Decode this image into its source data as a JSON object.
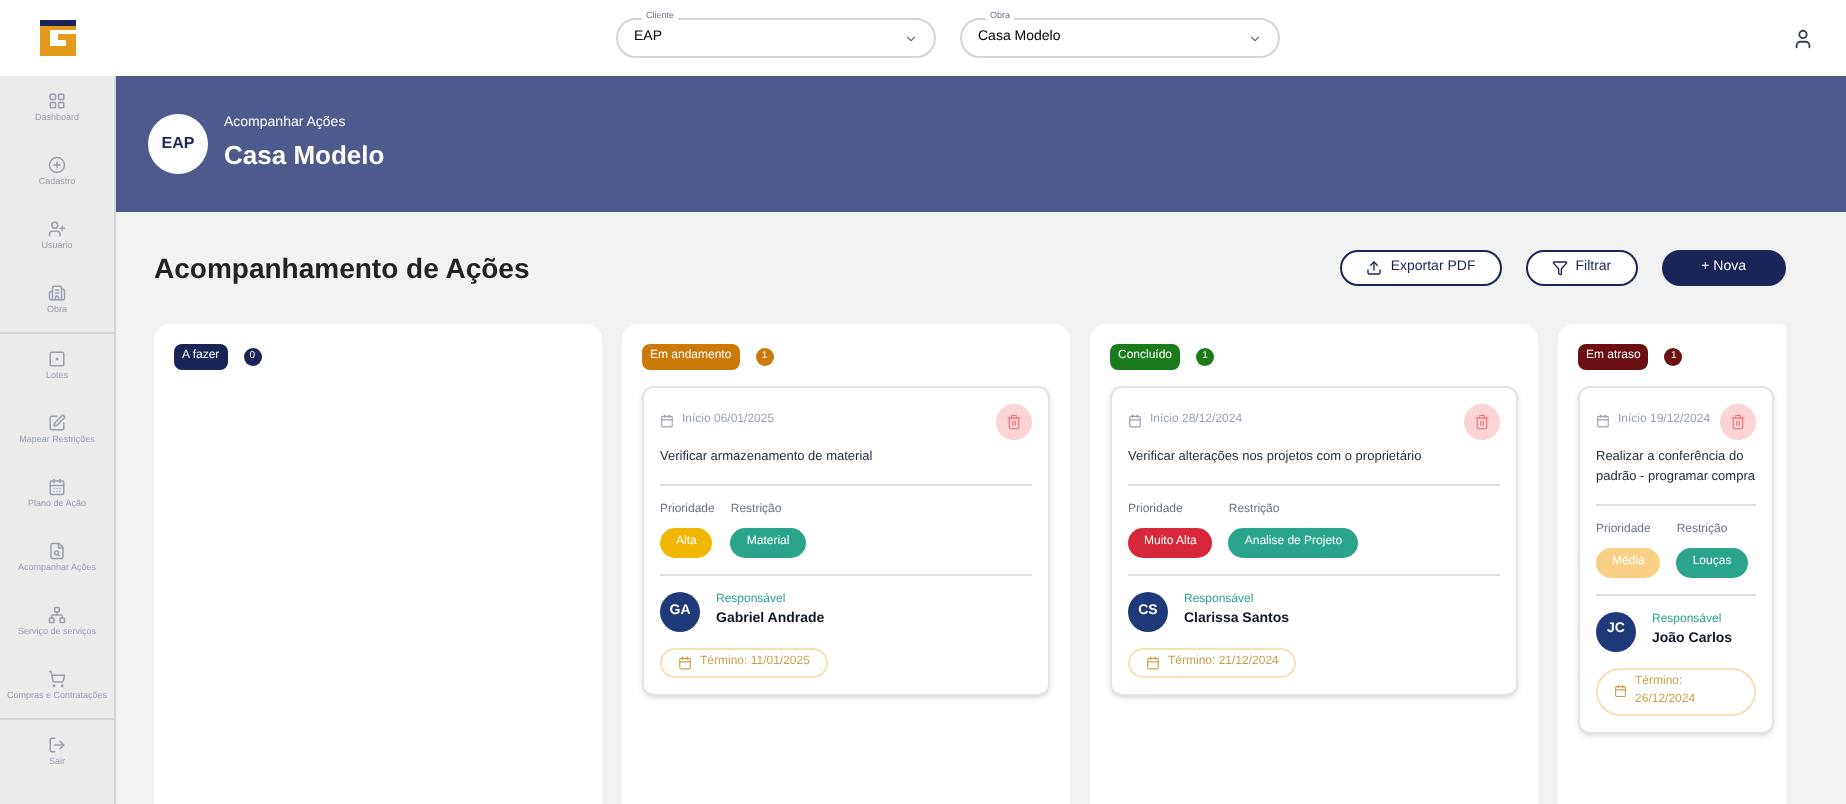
{
  "topbar": {
    "fields": [
      {
        "label": "Cliente",
        "value": "EAP"
      },
      {
        "label": "Obra",
        "value": "Casa Modelo"
      }
    ]
  },
  "sidebar": {
    "items": [
      {
        "label": "Dashboard"
      },
      {
        "label": "Cadastro"
      },
      {
        "label": "Usuário"
      },
      {
        "label": "Obra"
      },
      {
        "label": "Lotes"
      },
      {
        "label": "Mapear Restrições"
      },
      {
        "label": "Plano de Ação"
      },
      {
        "label": "Acompanhar Ações"
      },
      {
        "label": "Serviço de serviços"
      },
      {
        "label": "Compras e Contratações"
      },
      {
        "label": "Sair"
      }
    ]
  },
  "header": {
    "logo": "EAP",
    "subtitle": "Acompanhar Ações",
    "title": "Casa Modelo"
  },
  "page_title": "Acompanhamento de Ações",
  "buttons": [
    {
      "label": "Exportar PDF",
      "kind": "export"
    },
    {
      "label": "Filtrar",
      "kind": "filter"
    },
    {
      "label": "+ Nova",
      "kind": "primary"
    }
  ],
  "columns": [
    {
      "label": "A fazer",
      "count": "0",
      "color": "#1a2456"
    },
    {
      "label": "Em andamento",
      "count": "1",
      "color": "#c97a0a",
      "cards": [
        {
          "start": "Início 06/01/2025",
          "title": "Verificar armazenamento de material",
          "priority_label": "Prioridade",
          "restriction_label": "Restrição",
          "priority": {
            "label": "Alta",
            "color": "#f2b705"
          },
          "restriction": "Material",
          "responsible_label": "Responsável",
          "initials": "GA",
          "name": "Gabriel Andrade",
          "end": "Término: 11/01/2025"
        }
      ]
    },
    {
      "label": "Concluído",
      "count": "1",
      "color": "#1b7a1b",
      "cards": [
        {
          "start": "Início 28/12/2024",
          "title": "Verificar alterações nos projetos com o proprietário",
          "priority_label": "Prioridade",
          "restriction_label": "Restrição",
          "priority": {
            "label": "Muito Alta",
            "color": "#d62839"
          },
          "restriction": "Analise de Projeto",
          "responsible_label": "Responsável",
          "initials": "CS",
          "name": "Clarissa Santos",
          "end": "Término: 21/12/2024"
        }
      ]
    },
    {
      "label": "Em atraso",
      "count": "1",
      "color": "#6b0f12",
      "cards": [
        {
          "start": "Início 19/12/2024",
          "title": "Realizar a conferência do padrão - programar compra",
          "priority_label": "Prioridade",
          "restriction_label": "Restrição",
          "priority": {
            "label": "Média",
            "color": "#f7cf85"
          },
          "restriction": "Louças",
          "responsible_label": "Responsável",
          "initials": "JC",
          "name": "João Carlos",
          "end": "Término: 26/12/2024"
        }
      ]
    }
  ]
}
